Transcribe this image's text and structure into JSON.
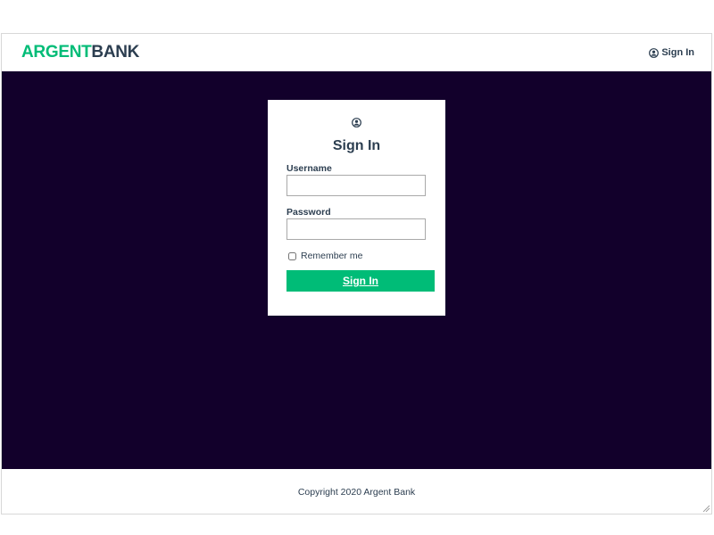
{
  "brand": {
    "part1": "ARGENT",
    "part2": "BANK"
  },
  "nav": {
    "signin_label": "Sign In"
  },
  "login": {
    "title": "Sign In",
    "username_label": "Username",
    "username_value": "",
    "password_label": "Password",
    "password_value": "",
    "remember_label": "Remember me",
    "remember_checked": false,
    "submit_label": "Sign In"
  },
  "footer": {
    "text": "Copyright 2020 Argent Bank"
  },
  "colors": {
    "brand_green": "#00bc77",
    "text_dark": "#2c3e50",
    "hero_background": "#12002b"
  },
  "icons": [
    "user-circle-icon",
    "resize-grip-icon"
  ]
}
